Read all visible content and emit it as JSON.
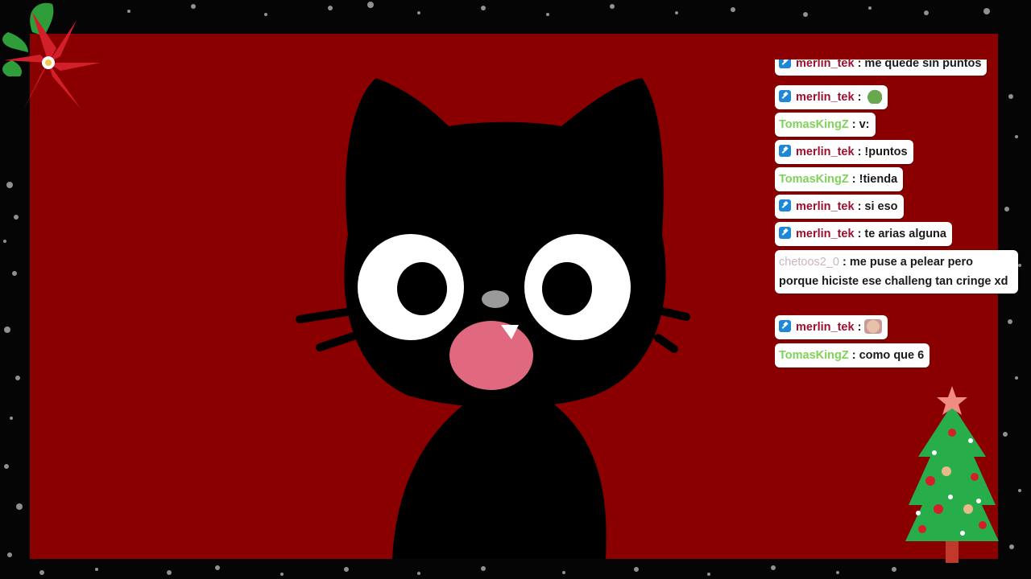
{
  "chat": {
    "messages": [
      {
        "user": "merlin_tek",
        "user_color": "#9e0f2d",
        "badge": "moderator-badge-icon",
        "text": ": me quede sin puntos"
      },
      {
        "user": "merlin_tek",
        "user_color": "#9e0f2d",
        "badge": "moderator-badge-icon",
        "text": ":",
        "emote": "pepe-frog-emote"
      },
      {
        "user": "TomasKingZ",
        "user_color": "#7fd35a",
        "badge": null,
        "text": ": v:"
      },
      {
        "user": "merlin_tek",
        "user_color": "#9e0f2d",
        "badge": "moderator-badge-icon",
        "text": ": !puntos"
      },
      {
        "user": "TomasKingZ",
        "user_color": "#7fd35a",
        "badge": null,
        "text": ": !tienda"
      },
      {
        "user": "merlin_tek",
        "user_color": "#9e0f2d",
        "badge": "moderator-badge-icon",
        "text": ": si eso"
      },
      {
        "user": "merlin_tek",
        "user_color": "#9e0f2d",
        "badge": "moderator-badge-icon",
        "text": ": te arias alguna"
      },
      {
        "user": "chetoos2_0",
        "user_color": "#c9b6bf",
        "badge": null,
        "text": ": me puse a pelear pero porque hiciste ese challeng tan cringe xd"
      },
      {
        "user": "merlin_tek",
        "user_color": "#9e0f2d",
        "badge": "moderator-badge-icon",
        "text": ":",
        "emote": "baby-face-emote"
      },
      {
        "user": "TomasKingZ",
        "user_color": "#7fd35a",
        "badge": null,
        "text": ": como que 6"
      }
    ]
  },
  "colors": {
    "stage_background": "#8a0000",
    "page_background": "#050505",
    "chat_bubble": "#ffffff"
  },
  "decorations": {
    "top_left": "poinsettia-icon",
    "bottom_right": "christmas-tree-icon",
    "center": "black-cat-avatar"
  }
}
